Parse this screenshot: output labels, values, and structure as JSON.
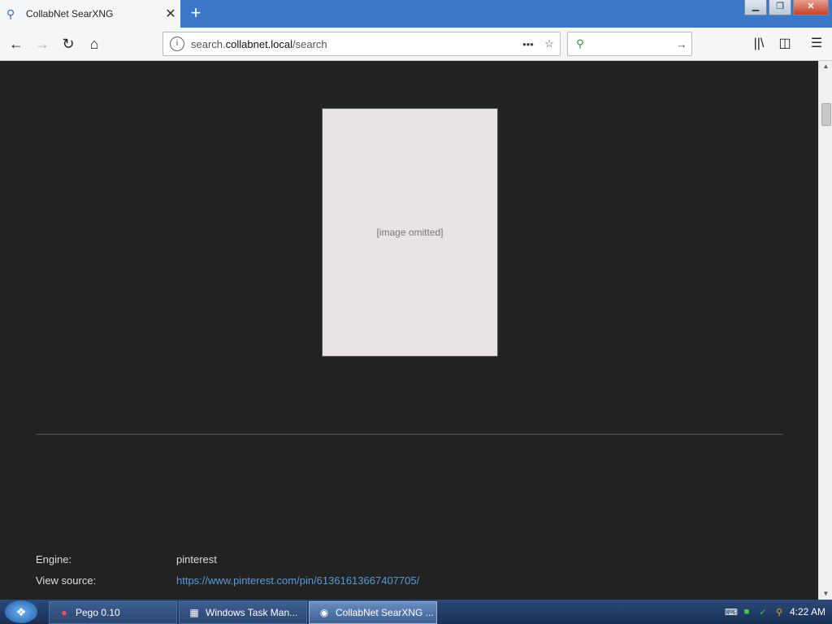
{
  "browser": {
    "tab_title": "CollabNet SearXNG",
    "tab_close": "✕",
    "new_tab": "+",
    "url_prefix": "search.",
    "url_domain": "collabnet.local",
    "url_path": "/search",
    "url_more": "•••",
    "search_query": "",
    "win_min": "▁",
    "win_max": "❐",
    "win_close": "✕"
  },
  "result": {
    "image_placeholder": "[image omitted]",
    "engine_label": "Engine:",
    "engine_value": "pinterest",
    "source_label": "View source:",
    "source_url": "https://www.pinterest.com/pin/61361613667407705/"
  },
  "taskbar": {
    "tasks": [
      {
        "label": "Pego 0.10",
        "icon": "pego-icon"
      },
      {
        "label": "Windows Task Man...",
        "icon": "task-manager-icon"
      },
      {
        "label": "CollabNet SearXNG ...",
        "icon": "browser-icon"
      }
    ],
    "clock": "4:22 AM"
  }
}
